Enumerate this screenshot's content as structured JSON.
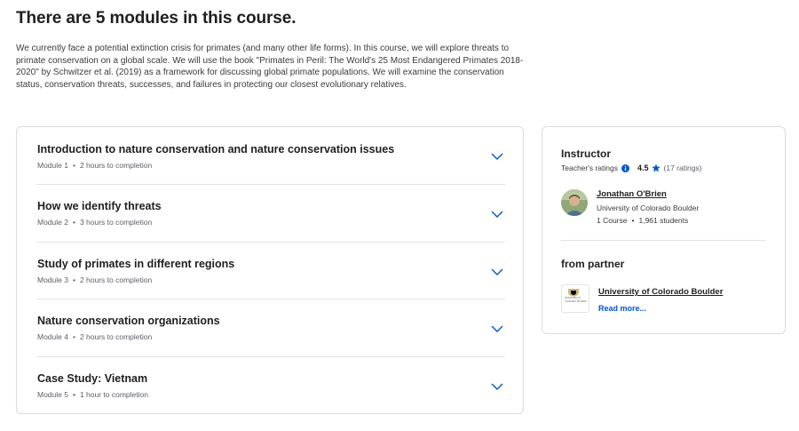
{
  "section": {
    "title": "There are 5 modules in this course.",
    "description": "We currently face a potential extinction crisis for primates (and many other life forms). In this course, we will explore threats to primate conservation on a global scale. We will use the book \"Primates in Peril: The World's 25 Most Endangered Primates 2018-2020\" by Schwitzer et al. (2019) as a framework for discussing global primate populations. We will examine the conservation status, conservation threats, successes, and failures in protecting our closest evolutionary relatives."
  },
  "modules": [
    {
      "title": "Introduction to nature conservation and nature conservation issues",
      "module_label": "Module 1",
      "duration": "2 hours to completion"
    },
    {
      "title": "How we identify threats",
      "module_label": "Module 2",
      "duration": "3 hours to completion"
    },
    {
      "title": "Study of primates in different regions",
      "module_label": "Module 3",
      "duration": "2 hours to completion"
    },
    {
      "title": "Nature conservation organizations",
      "module_label": "Module 4",
      "duration": "2 hours to completion"
    },
    {
      "title": "Case Study: Vietnam",
      "module_label": "Module 5",
      "duration": "1 hour to completion"
    }
  ],
  "instructor": {
    "heading": "Instructor",
    "ratings_label": "Teacher's ratings",
    "rating": "4.5",
    "rating_count": "(17 ratings)",
    "name": "Jonathan O'Brien",
    "university": "University of Colorado Boulder",
    "courses": "1 Course",
    "students": "1,961 students"
  },
  "partner": {
    "heading": "from partner",
    "name": "University of Colorado Boulder",
    "logo_text": "University of Colorado Boulder",
    "read_more": "Read more..."
  },
  "colors": {
    "accent": "#0056d2",
    "border": "#dadce0"
  },
  "icons": {
    "chevron": "chevron-down-icon",
    "info": "info-icon",
    "star": "star-icon"
  }
}
